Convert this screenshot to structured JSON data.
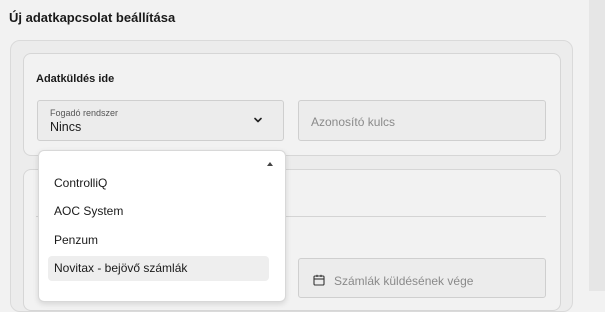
{
  "page": {
    "title": "Új adatkapcsolat beállítása"
  },
  "section": {
    "title": "Adatküldés ide"
  },
  "system_field": {
    "label": "Fogadó rendszer",
    "value": "Nincs"
  },
  "key_field": {
    "placeholder": "Azonosító kulcs"
  },
  "date_field": {
    "placeholder": "Számlák küldésének vége"
  },
  "dropdown": {
    "partial_item": "-",
    "items": [
      {
        "label": "ControlliQ"
      },
      {
        "label": "AOC System"
      },
      {
        "label": "Penzum"
      },
      {
        "label": "Novitax - bejövő számlák",
        "highlighted": true
      }
    ]
  },
  "icons": {
    "chevron": "chevron-down-icon",
    "calendar": "calendar-icon",
    "scroll_up": "scroll-up-arrow-icon"
  }
}
